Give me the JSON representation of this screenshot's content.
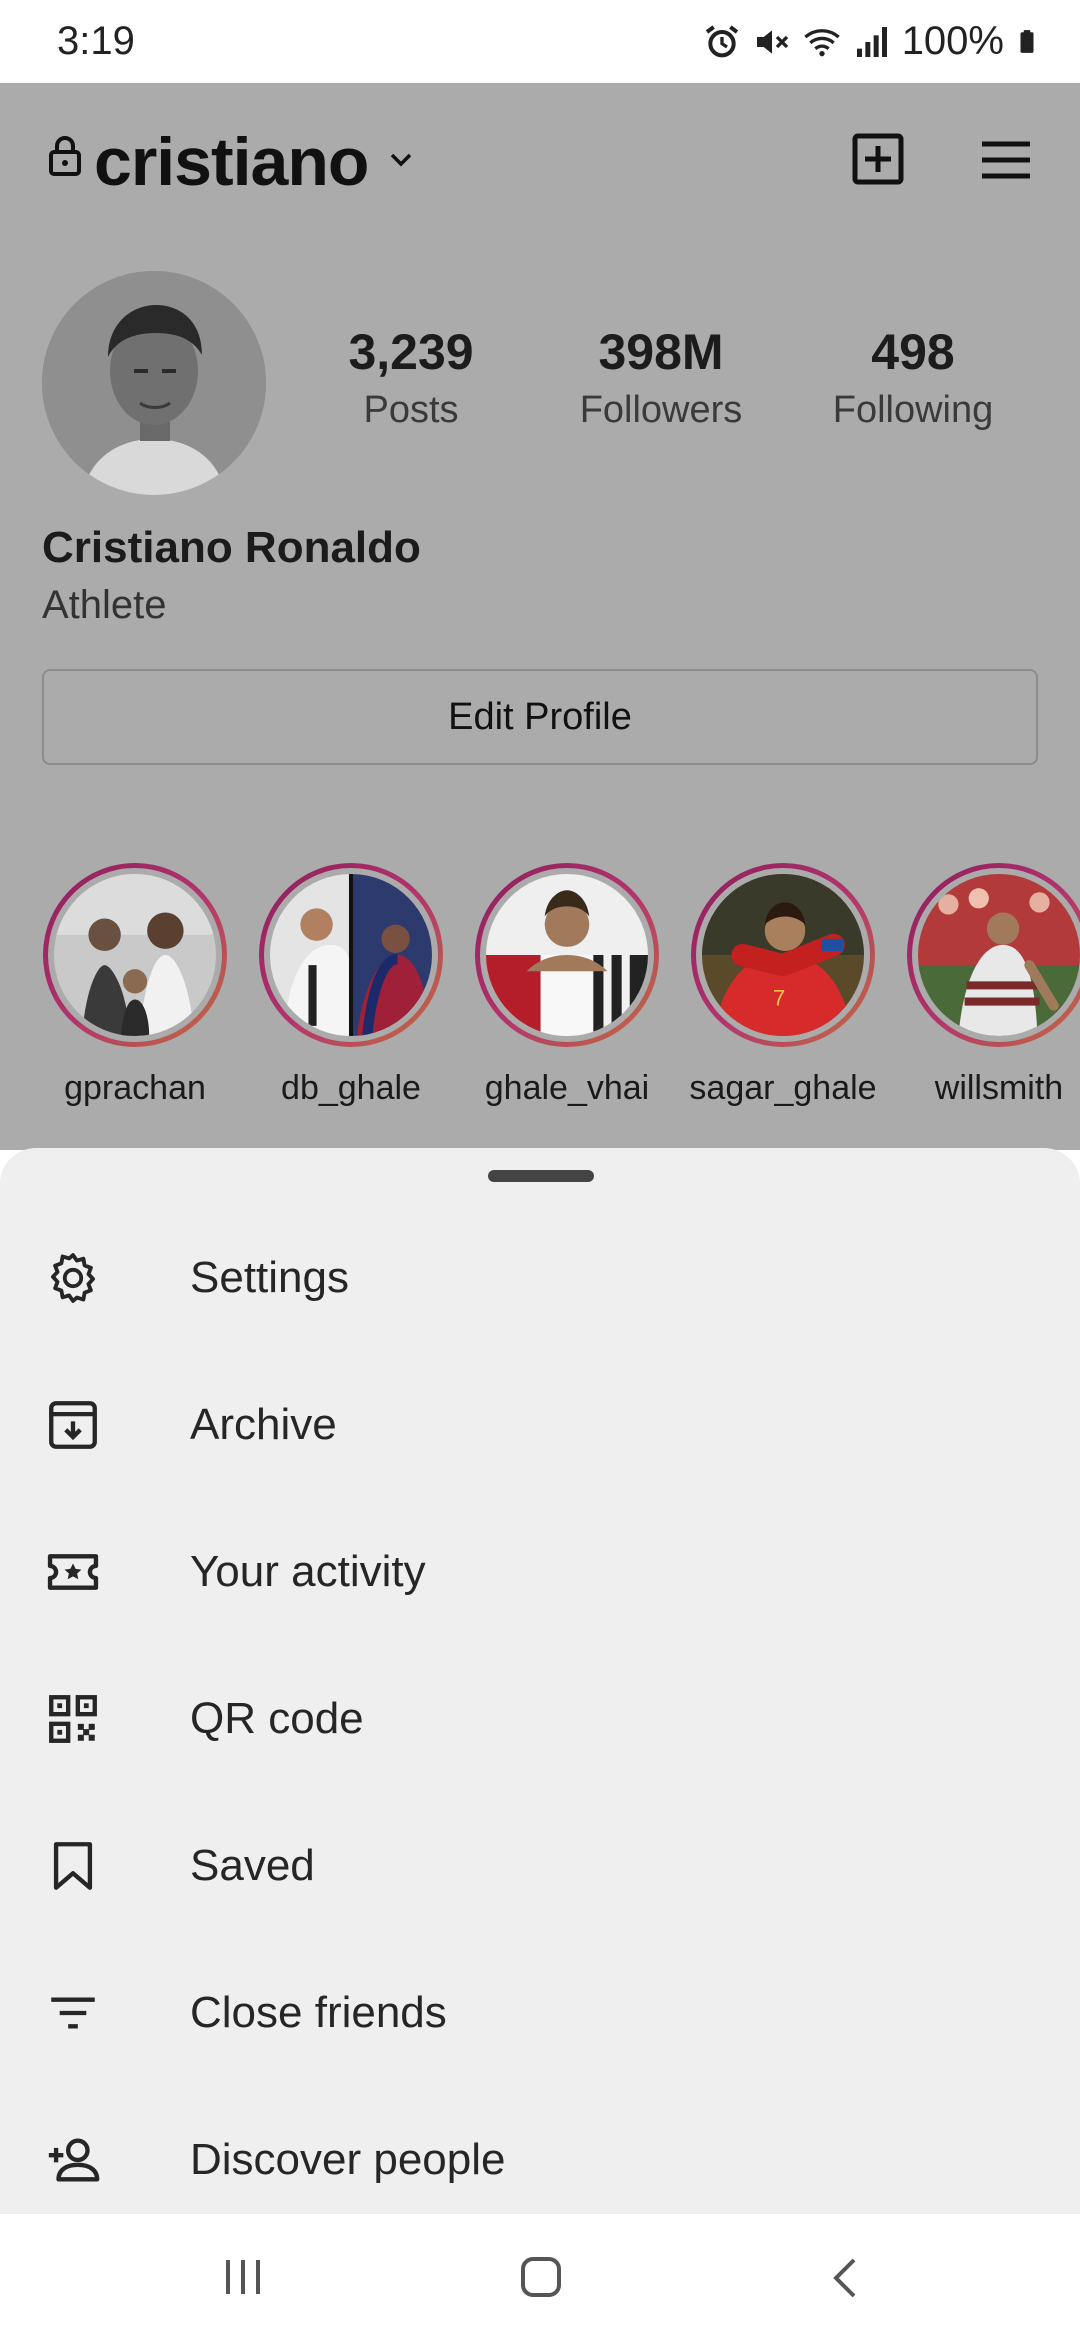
{
  "status_bar": {
    "time": "3:19",
    "battery": "100%",
    "icons": [
      "alarm-icon",
      "mute-icon",
      "wifi-icon",
      "signal-icon",
      "battery-icon"
    ]
  },
  "profile": {
    "username": "cristiano",
    "full_name": "Cristiano Ronaldo",
    "category": "Athlete",
    "stats": [
      {
        "value": "3,239",
        "label": "Posts"
      },
      {
        "value": "398M",
        "label": "Followers"
      },
      {
        "value": "498",
        "label": "Following"
      }
    ],
    "edit_profile_label": "Edit Profile"
  },
  "highlights": [
    {
      "label": "gprachan"
    },
    {
      "label": "db_ghale"
    },
    {
      "label": "ghale_vhai"
    },
    {
      "label": "sagar_ghale"
    },
    {
      "label": "willsmith"
    }
  ],
  "menu": {
    "items": [
      {
        "label": "Settings",
        "icon": "gear-icon"
      },
      {
        "label": "Archive",
        "icon": "archive-icon"
      },
      {
        "label": "Your activity",
        "icon": "activity-icon"
      },
      {
        "label": "QR code",
        "icon": "qr-code-icon"
      },
      {
        "label": "Saved",
        "icon": "bookmark-icon"
      },
      {
        "label": "Close friends",
        "icon": "close-friends-icon"
      },
      {
        "label": "Discover people",
        "icon": "add-person-icon"
      }
    ]
  },
  "colors": {
    "overlay": "#ababab",
    "sheet": "#efefef",
    "story_ring_start": "#8b1e5b",
    "story_ring_end": "#c2703f"
  }
}
